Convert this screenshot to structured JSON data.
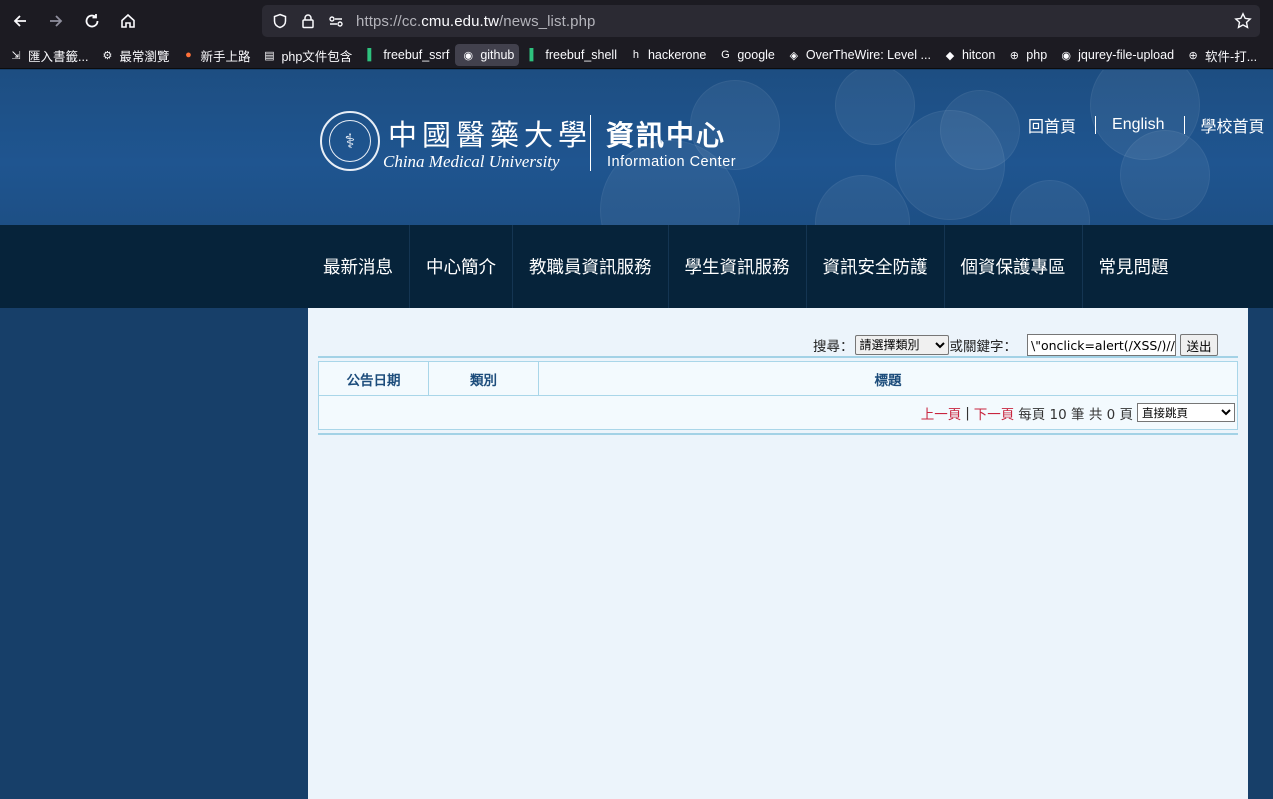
{
  "browser": {
    "url_prefix": "https://cc.",
    "url_host": "cmu.edu.tw",
    "url_path": "/news_list.php",
    "bookmarks": [
      {
        "label": "匯入書籤...",
        "icon": "import-icon"
      },
      {
        "label": "最常瀏覽",
        "icon": "gear-icon"
      },
      {
        "label": "新手上路",
        "icon": "firefox-icon"
      },
      {
        "label": "php文件包含",
        "icon": "page-icon"
      },
      {
        "label": "freebuf_ssrf",
        "icon": "freebuf-icon"
      },
      {
        "label": "github",
        "icon": "github-icon"
      },
      {
        "label": "freebuf_shell",
        "icon": "freebuf-icon"
      },
      {
        "label": "hackerone",
        "icon": "hackerone-icon"
      },
      {
        "label": "google",
        "icon": "google-icon"
      },
      {
        "label": "OverTheWire: Level ...",
        "icon": "overthewire-icon"
      },
      {
        "label": "hitcon",
        "icon": "hitcon-icon"
      },
      {
        "label": "php",
        "icon": "globe-icon"
      },
      {
        "label": "jqurey-file-upload",
        "icon": "github-icon"
      },
      {
        "label": "软件-打...",
        "icon": "globe-icon"
      }
    ]
  },
  "header": {
    "logo_cn": "中國醫藥大學",
    "logo_en": "China Medical University",
    "center_cn": "資訊中心",
    "center_en": "Information Center",
    "links": [
      "回首頁",
      "English",
      "學校首頁"
    ]
  },
  "nav": [
    "最新消息",
    "中心簡介",
    "教職員資訊服務",
    "學生資訊服務",
    "資訊安全防護",
    "個資保護專區",
    "常見問題"
  ],
  "search": {
    "label": "搜尋：",
    "category_selected": "請選擇類別",
    "keyword_label": "或關鍵字：",
    "keyword_value": "\\\"onclick=alert(/XSS/)//",
    "submit_label": "送出"
  },
  "table": {
    "columns": [
      "公告日期",
      "類別",
      "標題"
    ]
  },
  "pager": {
    "prev": "上一頁",
    "sep": "|",
    "next": "下一頁",
    "per_page_text": "每頁 10 筆 共 0 頁",
    "jump_selected": "直接跳頁"
  }
}
